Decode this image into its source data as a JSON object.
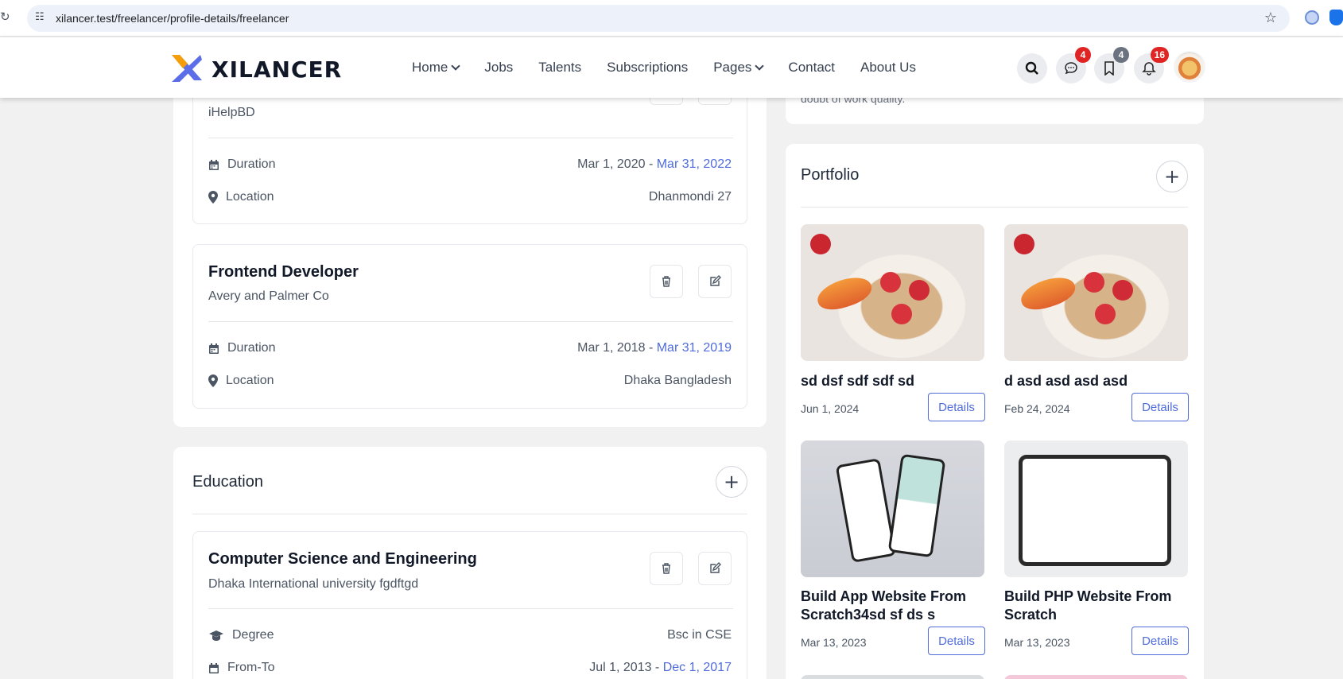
{
  "browser": {
    "url": "xilancer.test/freelancer/profile-details/freelancer"
  },
  "header": {
    "brand": "XILANCER",
    "nav": [
      "Home",
      "Jobs",
      "Talents",
      "Subscriptions",
      "Pages",
      "Contact",
      "About Us"
    ],
    "badges": {
      "messages": "4",
      "bookmarks": "4",
      "notifications": "16"
    },
    "colors": {
      "accent": "#4f6bdc",
      "logo_orange": "#f59e0b",
      "logo_blue": "#5b6ee8",
      "badge_red": "#e02424"
    }
  },
  "experience": {
    "first": {
      "company": "iHelpBD",
      "duration_label": "Duration",
      "duration_start": "Mar 1, 2020 -",
      "duration_end": "Mar 31, 2022",
      "location_label": "Location",
      "location": "Dhanmondi 27"
    },
    "second": {
      "title": "Frontend Developer",
      "company": "Avery and Palmer Co",
      "duration_label": "Duration",
      "duration_start": "Mar 1, 2018 -",
      "duration_end": "Mar 31, 2019",
      "location_label": "Location",
      "location": "Dhaka Bangladesh"
    }
  },
  "education": {
    "heading": "Education",
    "item": {
      "title": "Computer Science and Engineering",
      "institution": "Dhaka International university fgdftgd",
      "degree_label": "Degree",
      "degree": "Bsc in CSE",
      "fromto_label": "From-To",
      "fromto_start": "Jul 1, 2013 -",
      "fromto_end": "Dec 1, 2017"
    }
  },
  "side": {
    "top_text": "doubt of work quality."
  },
  "portfolio": {
    "heading": "Portfolio",
    "details_label": "Details",
    "items": [
      {
        "title": "sd dsf sdf sdf sd",
        "date": "Jun 1, 2024"
      },
      {
        "title": "d asd asd asd asd",
        "date": "Feb 24, 2024"
      },
      {
        "title": "Build App Website From Scratch34sd sf ds s",
        "date": "Mar 13, 2023"
      },
      {
        "title": "Build PHP Website From Scratch",
        "date": "Mar 13, 2023"
      }
    ]
  }
}
